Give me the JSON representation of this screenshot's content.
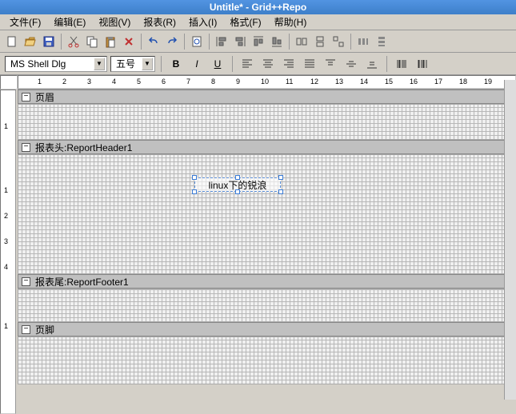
{
  "title": "Untitle* - Grid++Repo",
  "menu": {
    "file": "文件(F)",
    "edit": "编辑(E)",
    "view": "视图(V)",
    "report": "报表(R)",
    "insert": "插入(I)",
    "format": "格式(F)",
    "help": "帮助(H)"
  },
  "format_bar": {
    "font_name": "MS Shell Dlg",
    "font_size": "五号"
  },
  "sections": {
    "page_header": "页眉",
    "report_header": "报表头:ReportHeader1",
    "report_footer": "报表尾:ReportFooter1",
    "page_footer": "页脚"
  },
  "textbox_content": "linux下的锐浪",
  "ruler_h": [
    "1",
    "2",
    "3",
    "4",
    "5",
    "6",
    "7",
    "8",
    "9",
    "10",
    "11",
    "12",
    "13",
    "14",
    "15",
    "16",
    "17",
    "18",
    "19"
  ],
  "ruler_v_header": [
    "1"
  ],
  "ruler_v_report": [
    "1",
    "2",
    "3",
    "4"
  ],
  "ruler_v_footer": [
    "1"
  ]
}
